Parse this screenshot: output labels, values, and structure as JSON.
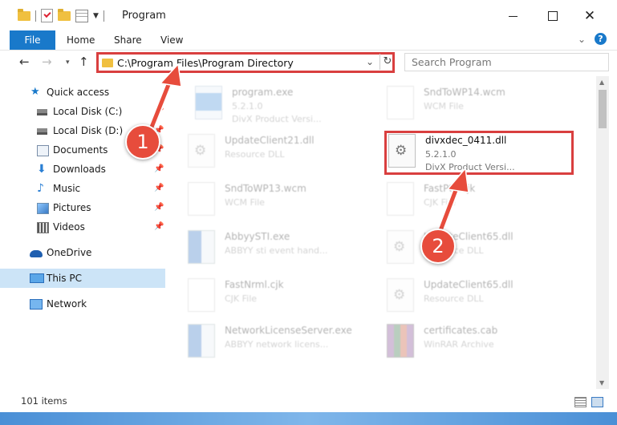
{
  "window": {
    "title": "Program"
  },
  "ribbon": {
    "tabs": [
      "File",
      "Home",
      "Share",
      "View"
    ],
    "help": "?"
  },
  "address": {
    "path": "C:\\Program Files\\Program Directory",
    "search_placeholder": "Search Program"
  },
  "sidebar": {
    "items": [
      {
        "label": "Quick access"
      },
      {
        "label": "Local Disk (C:)"
      },
      {
        "label": "Local Disk (D:)"
      },
      {
        "label": "Documents"
      },
      {
        "label": "Downloads"
      },
      {
        "label": "Music"
      },
      {
        "label": "Pictures"
      },
      {
        "label": "Videos"
      },
      {
        "label": "OneDrive"
      },
      {
        "label": "This PC"
      },
      {
        "label": "Network"
      }
    ]
  },
  "files": [
    {
      "name": "program.exe",
      "line2": "5.2.1.0",
      "line3": "DivX  Product Versi...",
      "icon": "exe"
    },
    {
      "name": "SndToWP14.wcm",
      "line2": "WCM File",
      "line3": "",
      "icon": "page"
    },
    {
      "name": "UpdateClient21.dll",
      "line2": "Resource DLL",
      "line3": "",
      "icon": "gear"
    },
    {
      "name": "divxdec_0411.dll",
      "line2": "5.2.1.0",
      "line3": "DivX  Product Versi...",
      "icon": "gear"
    },
    {
      "name": "SndToWP13.wcm",
      "line2": "WCM File",
      "line3": "",
      "icon": "page"
    },
    {
      "name": "FastPtn.cjk",
      "line2": "CJK File",
      "line3": "",
      "icon": "page"
    },
    {
      "name": "AbbyySTI.exe",
      "line2": "ABBYY sti event hand...",
      "line3": "",
      "icon": "win"
    },
    {
      "name": "UpdateClient65.dll",
      "line2": "Resource DLL",
      "line3": "",
      "icon": "gear"
    },
    {
      "name": "FastNrml.cjk",
      "line2": "CJK File",
      "line3": "",
      "icon": "page"
    },
    {
      "name": "UpdateClient65.dll",
      "line2": "Resource DLL",
      "line3": "",
      "icon": "gear"
    },
    {
      "name": "NetworkLicenseServer.exe",
      "line2": "ABBYY network licens...",
      "line3": "",
      "icon": "win"
    },
    {
      "name": "certificates.cab",
      "line2": "WinRAR Archive",
      "line3": "",
      "icon": "cab"
    }
  ],
  "annotations": {
    "step1": "1",
    "step2": "2",
    "highlight_color": "#d93f3f"
  },
  "status": {
    "item_count": "101 items"
  },
  "colors": {
    "accent": "#1979ca",
    "selection": "#cce4f7"
  }
}
